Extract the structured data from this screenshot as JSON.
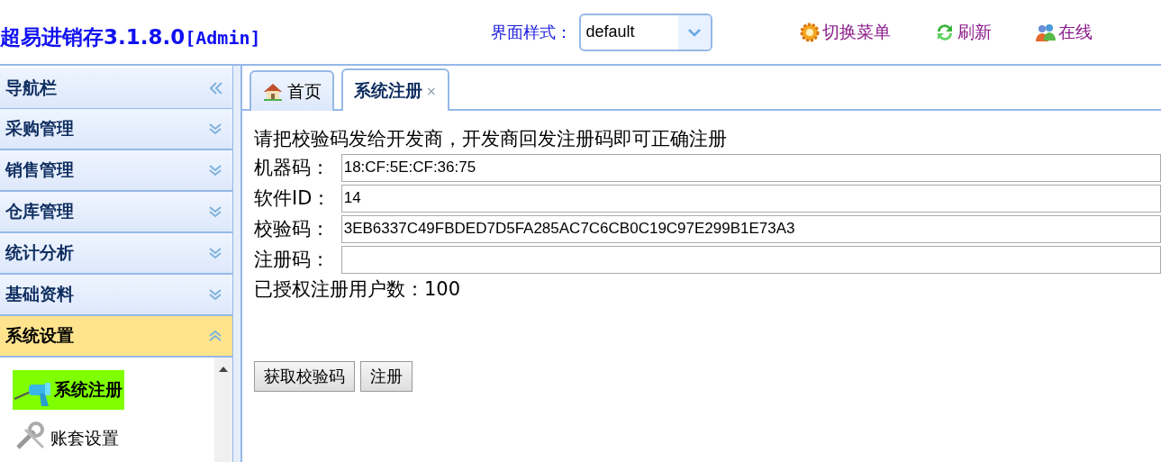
{
  "header": {
    "title": "超易进销存3.1.8.0",
    "user": "[Admin]",
    "theme_label": "界面样式：",
    "theme_value": "default",
    "actions": [
      {
        "label": "切换菜单",
        "kind": "gear"
      },
      {
        "label": "刷新",
        "kind": "refresh"
      },
      {
        "label": "在线",
        "kind": "users"
      }
    ]
  },
  "sidebar": {
    "title": "导航栏",
    "groups": [
      {
        "label": "采购管理",
        "expanded": false
      },
      {
        "label": "销售管理",
        "expanded": false
      },
      {
        "label": "仓库管理",
        "expanded": false
      },
      {
        "label": "统计分析",
        "expanded": false
      },
      {
        "label": "基础资料",
        "expanded": false
      },
      {
        "label": "系统设置",
        "expanded": true,
        "items": [
          {
            "label": "系统注册",
            "selected": true,
            "kind": "drill"
          },
          {
            "label": "账套设置",
            "selected": false,
            "kind": "wrench"
          }
        ]
      }
    ]
  },
  "tabs": [
    {
      "label": "首页",
      "selected": false,
      "kind": "home"
    },
    {
      "label": "系统注册",
      "selected": true,
      "close": "×"
    }
  ],
  "form": {
    "intro": "请把校验码发给开发商，开发商回发注册码即可正确注册",
    "fields": [
      {
        "label": "机器码：",
        "value": "18:CF:5E:CF:36:75"
      },
      {
        "label": "软件ID：",
        "value": "14"
      },
      {
        "label": "校验码：",
        "value": "3EB6337C49FBDED7D5FA285AC7C6CB0C19C97E299B1E73A3"
      },
      {
        "label": "注册码："
      }
    ],
    "note": "已授权注册用户数：100",
    "buttons": [
      "获取校验码",
      "注册"
    ]
  }
}
